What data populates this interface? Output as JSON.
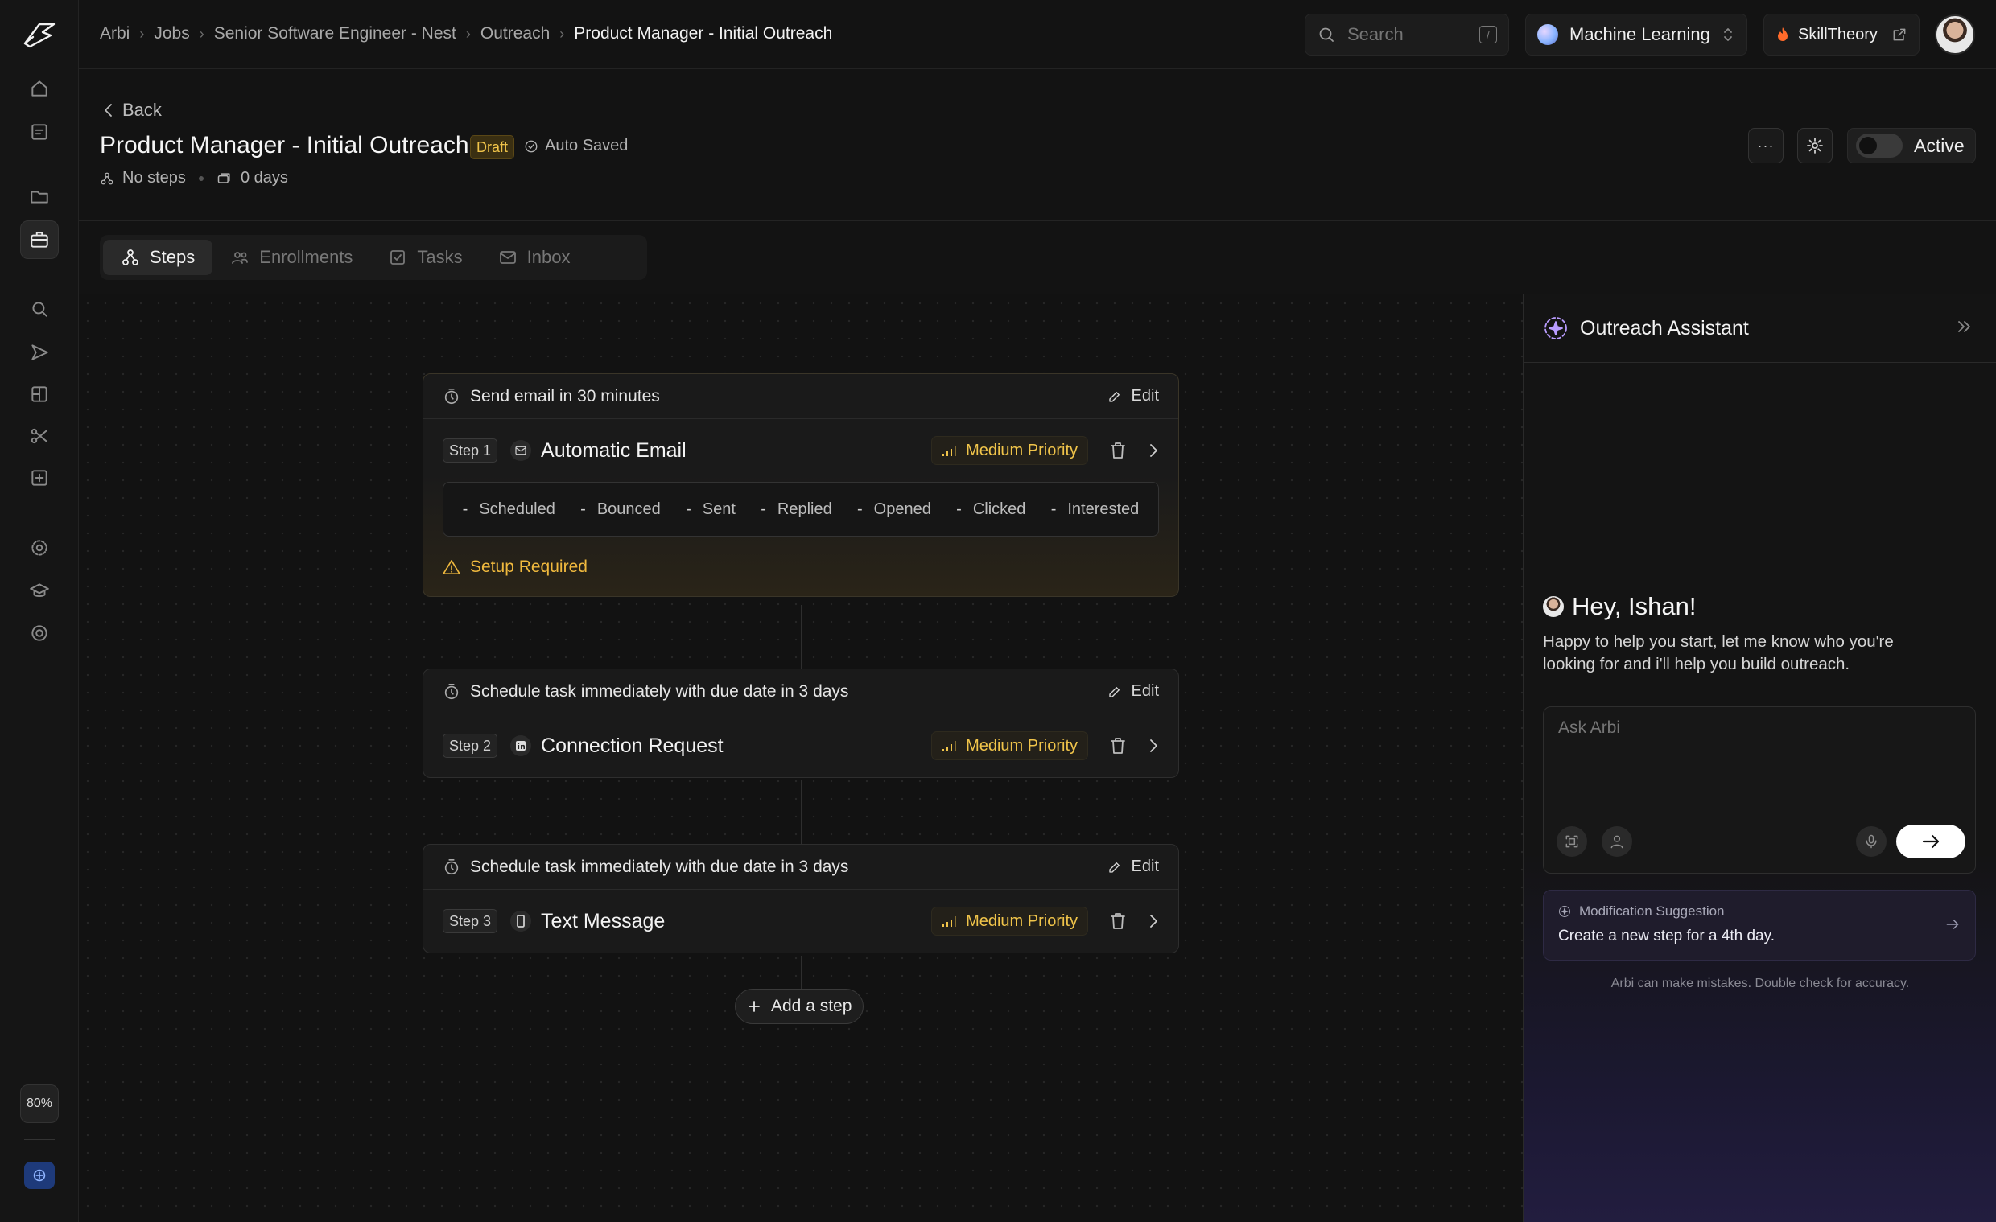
{
  "breadcrumb": [
    "Arbi",
    "Jobs",
    "Senior Software Engineer - Nest",
    "Outreach"
  ],
  "breadcrumb_current": "Product Manager - Initial Outreach",
  "search": {
    "placeholder": "Search",
    "shortcut": "/"
  },
  "workspace": "Machine Learning",
  "brand_link": "SkillTheory",
  "back_label": "Back",
  "page": {
    "title": "Product Manager - Initial Outreach",
    "status": "Draft",
    "autosave": "Auto Saved",
    "steps_count": "No steps",
    "duration": "0 days",
    "active_label": "Active",
    "more_label": "···"
  },
  "tabs": [
    {
      "label": "Steps",
      "icon": "steps-icon",
      "active": true
    },
    {
      "label": "Enrollments",
      "icon": "users-icon",
      "active": false
    },
    {
      "label": "Tasks",
      "icon": "checkbox-icon",
      "active": false
    },
    {
      "label": "Inbox",
      "icon": "mail-icon",
      "active": false
    }
  ],
  "steps": [
    {
      "schedule": "Send email in 30 minutes",
      "edit": "Edit",
      "tag": "Step 1",
      "type": "Automatic Email",
      "icon": "mail-icon",
      "priority": "Medium Priority",
      "stats": [
        "Scheduled",
        "Bounced",
        "Sent",
        "Replied",
        "Opened",
        "Clicked",
        "Interested"
      ],
      "stat_value": "-",
      "warning": "Setup Required"
    },
    {
      "schedule": "Schedule task immediately with due date in 3 days",
      "edit": "Edit",
      "tag": "Step 2",
      "type": "Connection Request",
      "icon": "linkedin-icon",
      "priority": "Medium Priority"
    },
    {
      "schedule": "Schedule task immediately with due date in 3 days",
      "edit": "Edit",
      "tag": "Step 3",
      "type": "Text Message",
      "icon": "phone-icon",
      "priority": "Medium Priority"
    }
  ],
  "add_step_label": "Add a step",
  "assistant": {
    "title": "Outreach Assistant",
    "greeting": "Hey, Ishan!",
    "intro": "Happy to help you start, let me know who you're looking for and i'll help you build outreach.",
    "input_placeholder": "Ask Arbi",
    "suggestion_label": "Modification Suggestion",
    "suggestion_text": "Create a new step for a 4th day.",
    "disclaimer": "Arbi can make mistakes. Double check for accuracy."
  },
  "zoom_level": "80%",
  "colors": {
    "background": "#131313",
    "priority": "#f0c44a",
    "warning": "#f0b93e",
    "assistant_accent": "#b99cff"
  }
}
